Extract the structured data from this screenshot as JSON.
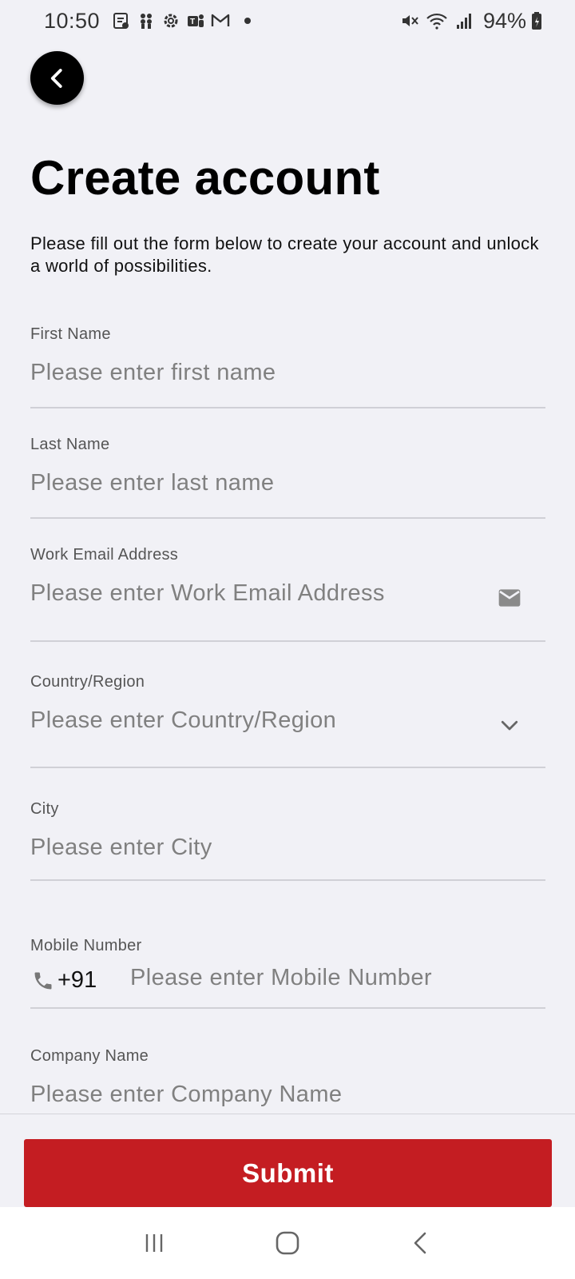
{
  "status_bar": {
    "time": "10:50",
    "battery": "94%",
    "icons_left": [
      "notes-icon",
      "slack-icon",
      "settings-icon",
      "teams-icon",
      "gmail-icon"
    ],
    "icons_right": [
      "mute-icon",
      "wifi-icon",
      "signal-icon",
      "battery-icon"
    ]
  },
  "header": {
    "back_icon": "chevron-left-icon",
    "title": "Create account",
    "subtitle": "Please fill out the form below to create your account and unlock a world of possibilities."
  },
  "form": {
    "first_name": {
      "label": "First Name",
      "placeholder": "Please enter first name",
      "value": ""
    },
    "last_name": {
      "label": "Last Name",
      "placeholder": "Please enter last name",
      "value": ""
    },
    "work_email": {
      "label": "Work Email Address",
      "placeholder": "Please enter Work Email Address",
      "value": "",
      "icon": "mail-icon"
    },
    "country": {
      "label": "Country/Region",
      "placeholder": "Please enter Country/Region",
      "value": "",
      "icon": "chevron-down-icon"
    },
    "city": {
      "label": "City",
      "placeholder": "Please enter City",
      "value": ""
    },
    "mobile": {
      "label": "Mobile Number",
      "country_code": "+91",
      "placeholder": "Please enter Mobile Number",
      "value": "",
      "icon": "phone-icon"
    },
    "company": {
      "label": "Company Name",
      "placeholder": "Please enter Company Name",
      "value": ""
    }
  },
  "actions": {
    "submit_label": "Submit",
    "submit_color": "#c41d22"
  },
  "nav_bar": {
    "recents_icon": "recents-icon",
    "home_icon": "home-icon",
    "back_icon": "back-icon"
  }
}
